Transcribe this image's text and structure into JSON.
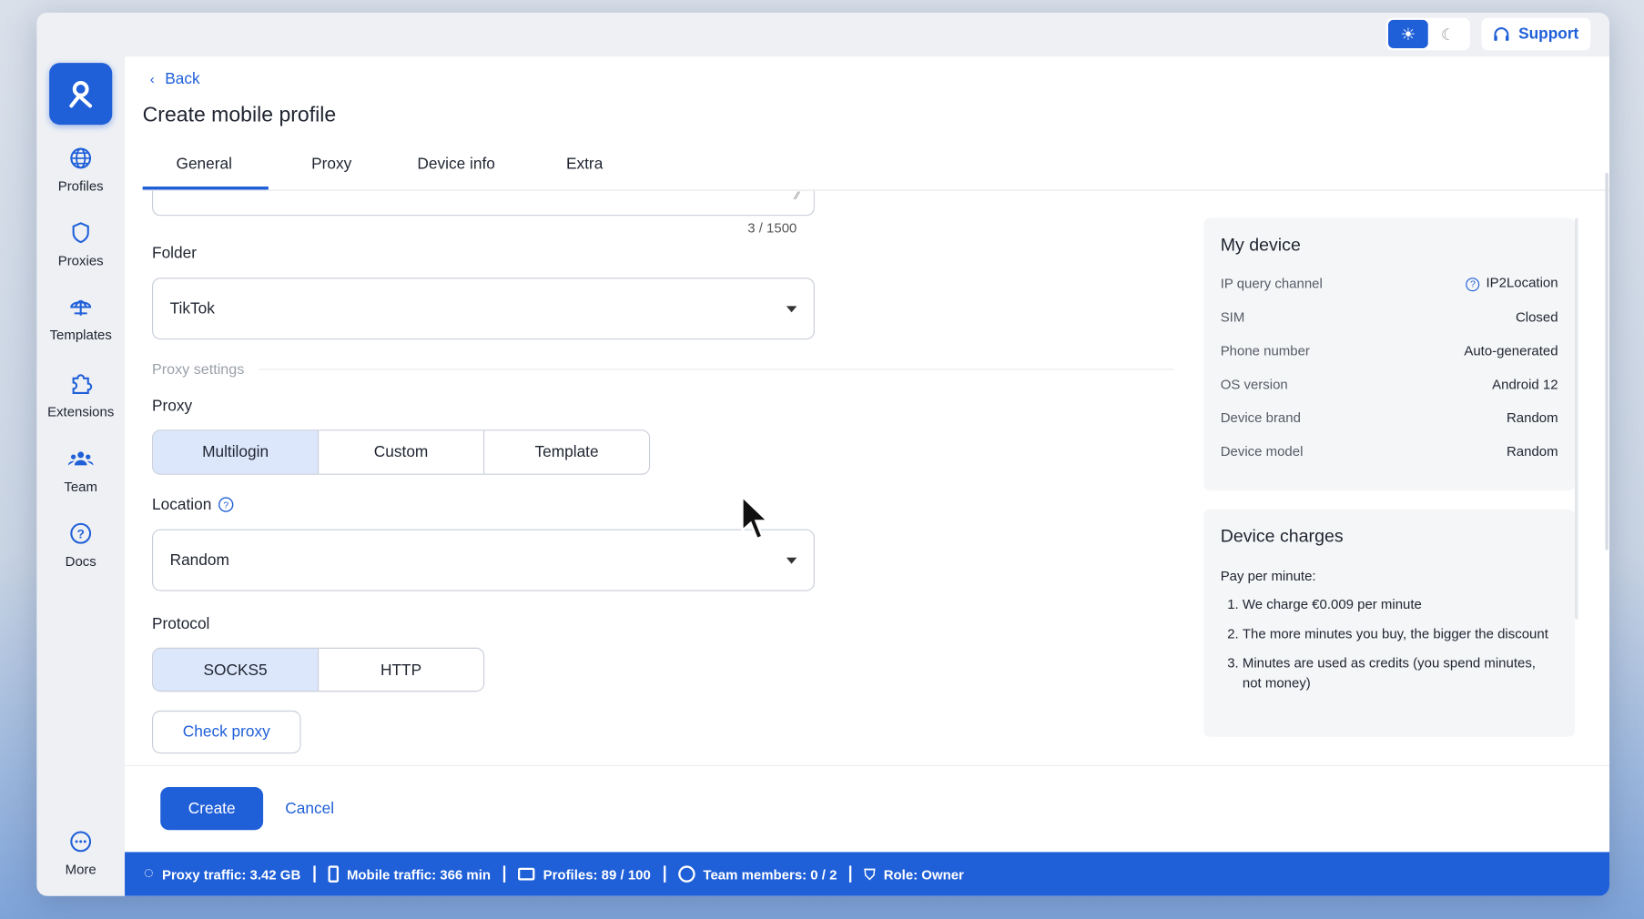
{
  "sidebar": {
    "items": [
      {
        "label": "Profiles",
        "icon": "globe-icon"
      },
      {
        "label": "Proxies",
        "icon": "shield-icon"
      },
      {
        "label": "Templates",
        "icon": "umbrella-icon"
      },
      {
        "label": "Extensions",
        "icon": "puzzle-icon"
      },
      {
        "label": "Team",
        "icon": "team-icon"
      },
      {
        "label": "Docs",
        "icon": "help-icon"
      }
    ],
    "more": "More"
  },
  "topbar": {
    "support": "Support"
  },
  "header": {
    "back": "Back",
    "title": "Create mobile profile"
  },
  "tabs": [
    "General",
    "Proxy",
    "Device info",
    "Extra"
  ],
  "form": {
    "notes_counter": "3 / 1500",
    "folder_label": "Folder",
    "folder_value": "TikTok",
    "proxy_settings": "Proxy settings",
    "proxy_label": "Proxy",
    "proxy_options": [
      "Multilogin",
      "Custom",
      "Template"
    ],
    "location_label": "Location",
    "location_value": "Random",
    "protocol_label": "Protocol",
    "protocol_options": [
      "SOCKS5",
      "HTTP"
    ],
    "check_proxy": "Check proxy"
  },
  "actions": {
    "create": "Create",
    "cancel": "Cancel"
  },
  "my_device": {
    "title": "My device",
    "rows": [
      {
        "k": "IP query channel",
        "v": "IP2Location"
      },
      {
        "k": "SIM",
        "v": "Closed"
      },
      {
        "k": "Phone number",
        "v": "Auto-generated"
      },
      {
        "k": "OS version",
        "v": "Android 12"
      },
      {
        "k": "Device brand",
        "v": "Random"
      },
      {
        "k": "Device model",
        "v": "Random"
      }
    ]
  },
  "charges": {
    "title": "Device charges",
    "intro": "Pay per minute:",
    "items": [
      "We charge €0.009 per minute",
      "The more minutes you buy, the bigger the discount",
      "Minutes are used as credits (you spend minutes, not money)"
    ]
  },
  "footer": {
    "proxy_traffic": "Proxy traffic: 3.42 GB",
    "mobile_traffic": "Mobile traffic: 366 min",
    "profiles": "Profiles: 89 / 100",
    "team": "Team members: 0 / 2",
    "role": "Role: Owner"
  },
  "colors": {
    "accent": "#1f5fd8",
    "selected": "#dce7fb"
  }
}
